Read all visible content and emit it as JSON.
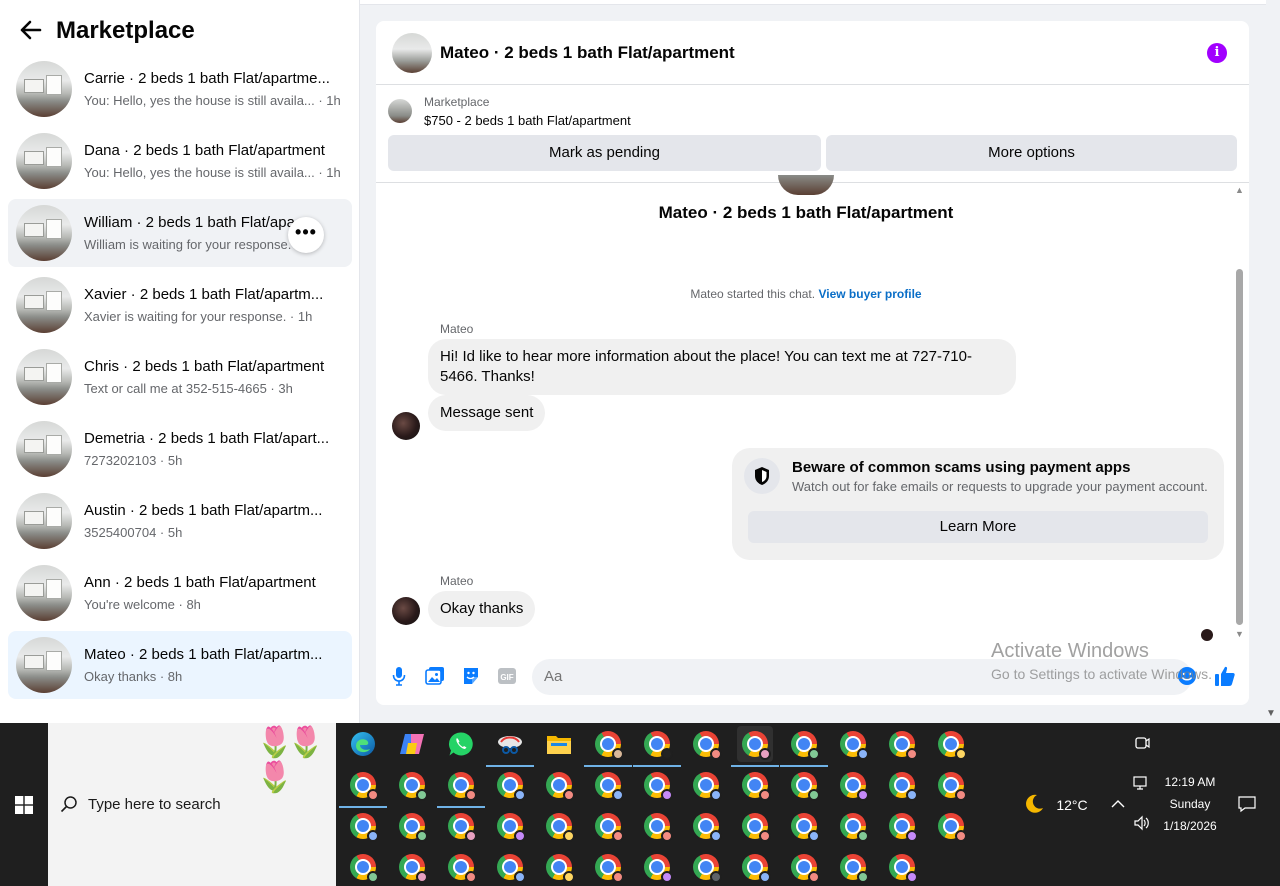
{
  "sidebar": {
    "title": "Marketplace",
    "back_icon": "arrow-left-icon",
    "conversations": [
      {
        "name": "Carrie · 2 beds 1 bath Flat/apartme...",
        "preview": "You: Hello, yes the house is still availa... · 1h"
      },
      {
        "name": "Dana · 2 beds 1 bath Flat/apartment",
        "preview": "You: Hello, yes the house is still availa... · 1h"
      },
      {
        "name": "William · 2 beds 1 bath Flat/apa",
        "preview": "William is waiting for your response."
      },
      {
        "name": "Xavier · 2 beds 1 bath Flat/apartm...",
        "preview": "Xavier is waiting for your response. · 1h"
      },
      {
        "name": "Chris · 2 beds 1 bath Flat/apartment",
        "preview": "Text or call me at 352-515-4665 · 3h"
      },
      {
        "name": "Demetria · 2 beds 1 bath Flat/apart...",
        "preview": "7273202103 · 5h"
      },
      {
        "name": "Austin · 2 beds 1 bath Flat/apartm...",
        "preview": "3525400704 · 5h"
      },
      {
        "name": "Ann · 2 beds 1 bath Flat/apartment",
        "preview": "You're welcome · 8h"
      },
      {
        "name": "Mateo · 2 beds 1 bath Flat/apartm...",
        "preview": "Okay thanks · 8h"
      }
    ],
    "more_button": "•••"
  },
  "chat": {
    "title": "Mateo · 2 beds 1 bath Flat/apartment",
    "info_icon": "info-icon",
    "listing": {
      "source": "Marketplace",
      "title": "$750 - 2 beds 1 bath Flat/apartment",
      "mark_pending": "Mark as pending",
      "more_options": "More options"
    },
    "thread_title": "Mateo · 2 beds 1 bath Flat/apartment",
    "started_text": "Mateo started this chat.",
    "view_profile": "View buyer profile",
    "messages": [
      {
        "sender": "Mateo",
        "text": "Hi! Id like to hear more information about the place! You can text me at 727-710-5466. Thanks!"
      },
      {
        "text": "Message sent"
      },
      {
        "sender": "Mateo",
        "text": "Okay thanks"
      }
    ],
    "scam_card": {
      "icon": "shield-icon",
      "title": "Beware of common scams using payment apps",
      "description": "Watch out for fake emails or requests to upgrade your payment account.",
      "button": "Learn More"
    },
    "composer": {
      "placeholder": "Aa",
      "icons": [
        "microphone-icon",
        "image-icon",
        "sticker-icon",
        "gif-icon",
        "emoji-icon",
        "thumbs-up-icon"
      ]
    }
  },
  "watermark": {
    "title": "Activate Windows",
    "subtitle": "Go to Settings to activate Windows."
  },
  "taskbar": {
    "search_placeholder": "Type here to search",
    "weather": "12°C",
    "time": "12:19 AM",
    "day": "Sunday",
    "date": "1/18/2026",
    "chrome_badge_colors": [
      "#e8a0c0",
      "#f28b82",
      "#c58af9",
      "#8ab4f8",
      "#81c995",
      "#fdd663"
    ]
  }
}
